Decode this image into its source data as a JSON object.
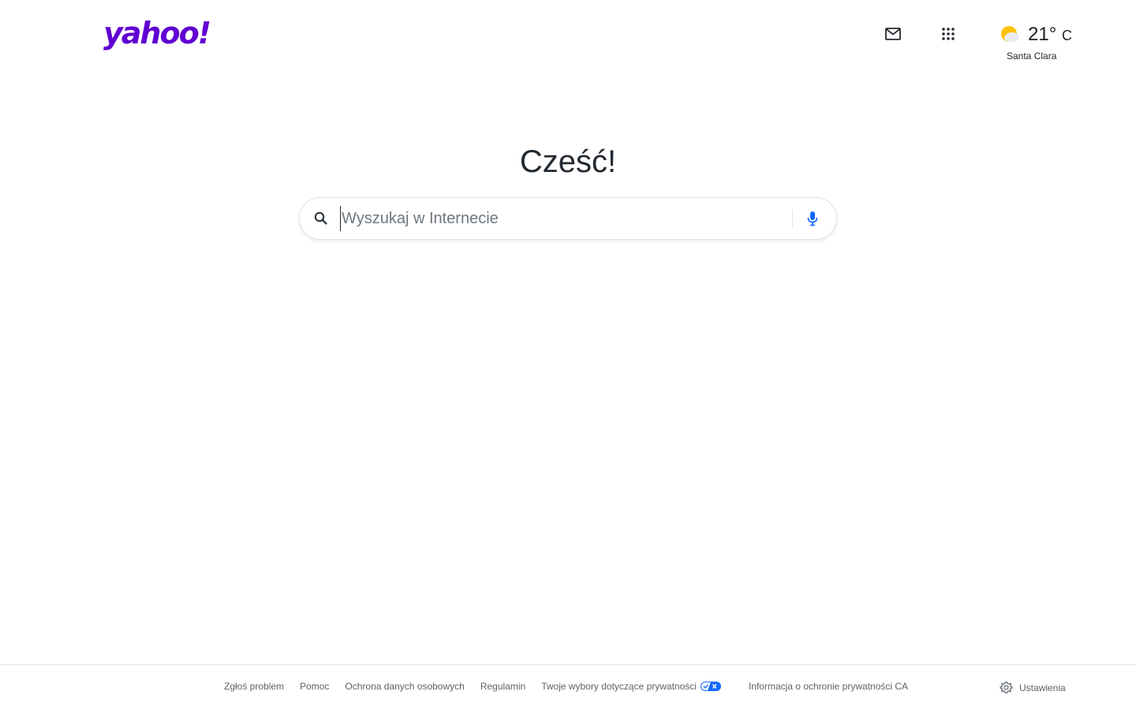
{
  "header": {
    "logo_text": "yahoo!",
    "mail_icon": "mail-icon",
    "apps_icon": "apps-grid-icon",
    "weather": {
      "temperature": "21°",
      "unit": "C",
      "city": "Santa Clara",
      "icon": "partly-cloudy-icon"
    }
  },
  "main": {
    "greeting": "Cześć!",
    "search": {
      "placeholder": "Wyszukaj w Internecie",
      "value": ""
    }
  },
  "footer": {
    "links": [
      "Zgłoś problem",
      "Pomoc",
      "Ochrona danych osobowych",
      "Regulamin",
      "Twoje wybory dotyczące prywatności",
      "Informacja o ochronie prywatności CA"
    ],
    "settings_label": "Ustawienia"
  },
  "colors": {
    "brand": "#6001d2",
    "mic": "#0f69ff",
    "privacy_badge": "#0f69ff"
  }
}
